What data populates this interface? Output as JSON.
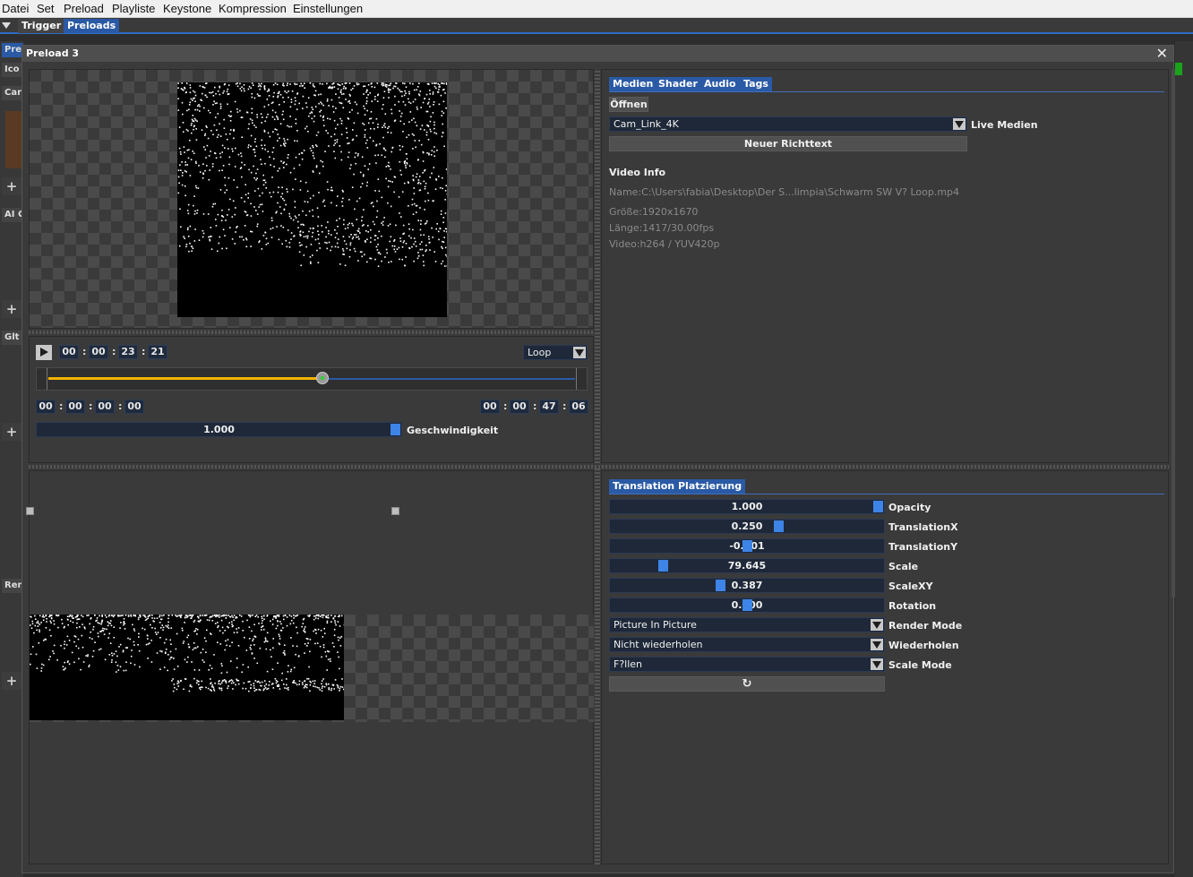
{
  "menu": [
    "Datei",
    "Set",
    "Preload",
    "Playliste",
    "Keystone",
    "Kompression",
    "Einstellungen"
  ],
  "toolbar": {
    "tabs": [
      "Trigger",
      "Preloads"
    ]
  },
  "background_tabs": [
    "Pre",
    "Ico",
    "Car",
    "AI G",
    "Glt",
    "Ren"
  ],
  "dialog": {
    "title": "Preload 3"
  },
  "player": {
    "current_time": [
      "00",
      "00",
      "23",
      "21"
    ],
    "start_time": [
      "00",
      "00",
      "00",
      "00"
    ],
    "end_time": [
      "00",
      "00",
      "47",
      "06"
    ],
    "loop_mode": "Loop",
    "progress": 0.52,
    "speed": {
      "value": "1.000",
      "label": "Geschwindigkeit"
    }
  },
  "media": {
    "tabs": [
      "Medien",
      "Shader",
      "Audio",
      "Tags"
    ],
    "open_button": "Öffnen",
    "source": "Cam_Link_4K",
    "live_label": "Live Medien",
    "richtext_button": "Neuer Richttext",
    "video_info_title": "Video Info",
    "name": "Name:C:\\Users\\fabia\\Desktop\\Der S...limpia\\Schwarm SW V? Loop.mp4",
    "size": "Größe:1920x1670",
    "length": "Länge:1417/30.00fps",
    "codec": "Video:h264 / YUV420p"
  },
  "transform": {
    "tabs": [
      "Translation",
      "Platzierung"
    ],
    "params": [
      {
        "label": "Opacity",
        "value": "1.000",
        "level": 1.0
      },
      {
        "label": "TranslationX",
        "value": "0.250",
        "level": 0.62
      },
      {
        "label": "TranslationY",
        "value": "-0.001",
        "level": 0.5
      },
      {
        "label": "Scale",
        "value": "79.645",
        "level": 0.18
      },
      {
        "label": "ScaleXY",
        "value": "0.387",
        "level": 0.4
      },
      {
        "label": "Rotation",
        "value": "0.000",
        "level": 0.5
      }
    ],
    "dropdowns": [
      {
        "label": "Render Mode",
        "value": "Picture In Picture"
      },
      {
        "label": "Wiederholen",
        "value": "Nicht wiederholen"
      },
      {
        "label": "Scale Mode",
        "value": "F?llen"
      }
    ],
    "reset_icon": "reset-icon"
  },
  "colors": {
    "accent": "#2a5aa5",
    "progress": "#f0b400",
    "knob": "#3d84e6"
  }
}
